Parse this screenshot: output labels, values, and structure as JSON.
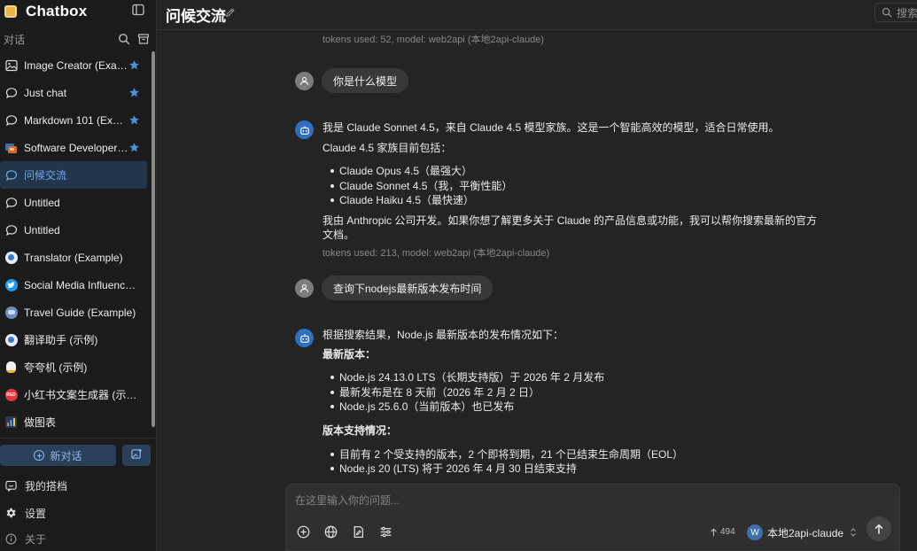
{
  "app": {
    "name": "Chatbox"
  },
  "sidebar": {
    "section_label": "对话",
    "items": [
      {
        "label": "Image Creator (Example)",
        "icon": "image-icon",
        "starred": true,
        "active": false
      },
      {
        "label": "Just chat",
        "icon": "chat-bubble-icon",
        "starred": true,
        "active": false
      },
      {
        "label": "Markdown 101 (Example)",
        "icon": "chat-bubble-icon",
        "starred": true,
        "active": false
      },
      {
        "label": "Software Developer (Example)",
        "icon": "developer-avatar-icon",
        "starred": true,
        "active": false
      },
      {
        "label": "问候交流",
        "icon": "chat-bubble-icon",
        "starred": false,
        "active": true
      },
      {
        "label": "Untitled",
        "icon": "chat-bubble-icon",
        "starred": false,
        "active": false
      },
      {
        "label": "Untitled",
        "icon": "chat-bubble-icon",
        "starred": false,
        "active": false
      },
      {
        "label": "Translator (Example)",
        "icon": "translator-avatar-icon",
        "starred": false,
        "active": false
      },
      {
        "label": "Social Media Influencer (Example)",
        "icon": "twitter-avatar-icon",
        "starred": false,
        "active": false
      },
      {
        "label": "Travel Guide (Example)",
        "icon": "travel-avatar-icon",
        "starred": false,
        "active": false
      },
      {
        "label": "翻译助手 (示例)",
        "icon": "translator-avatar-icon",
        "starred": false,
        "active": false
      },
      {
        "label": "夸夸机 (示例)",
        "icon": "praise-avatar-icon",
        "starred": false,
        "active": false
      },
      {
        "label": "小红书文案生成器 (示例)",
        "icon": "xiaohongshu-avatar-icon",
        "starred": false,
        "active": false
      },
      {
        "label": "做图表",
        "icon": "chart-avatar-icon",
        "starred": false,
        "active": false
      }
    ],
    "new_chat_label": "新对话",
    "bottom": {
      "copilots_label": "我的搭档",
      "settings_label": "设置",
      "about_label": "关于"
    }
  },
  "header": {
    "title": "问候交流",
    "search_placeholder": "搜索"
  },
  "messages": {
    "prev_meta": "tokens used: 52, model: web2api (本地2api-claude)",
    "user1": "你是什么模型",
    "bot1": {
      "intro": "我是 Claude Sonnet 4.5，来自 Claude 4.5 模型家族。这是一个智能高效的模型，适合日常使用。",
      "family_heading": "Claude 4.5 家族目前包括：",
      "family": [
        "Claude Opus 4.5（最强大）",
        "Claude Sonnet 4.5（我，平衡性能）",
        "Claude Haiku 4.5（最快速）"
      ],
      "outro": "我由 Anthropic 公司开发。如果你想了解更多关于 Claude 的产品信息或功能，我可以帮你搜索最新的官方文档。",
      "meta": "tokens used: 213, model: web2api (本地2api-claude)"
    },
    "user2": "查询下nodejs最新版本发布时间",
    "bot2": {
      "intro": "根据搜索结果，Node.js 最新版本的发布情况如下：",
      "latest_heading": "最新版本：",
      "latest": [
        "Node.js 24.13.0 LTS（长期支持版）于 2026 年 2 月发布",
        "最新发布是在 8 天前（2026 年 2 月 2 日）",
        "Node.js 25.6.0（当前版本）也已发布"
      ],
      "support_heading": "版本支持情况：",
      "support": [
        "目前有 2 个受支持的版本，2 个即将到期，21 个已结束生命周期（EOL）",
        "Node.js 20 (LTS) 将于 2026 年 4 月 30 日结束支持"
      ]
    }
  },
  "composer": {
    "placeholder": "在这里输入你的问题...",
    "token_count": "494",
    "model_avatar_letter": "W",
    "model_name": "本地2api-claude"
  },
  "colors": {
    "accent": "#6fa8ef",
    "star": "#4a8fe0",
    "sidebar_bg": "#1b1b1b",
    "main_bg": "#242424"
  }
}
